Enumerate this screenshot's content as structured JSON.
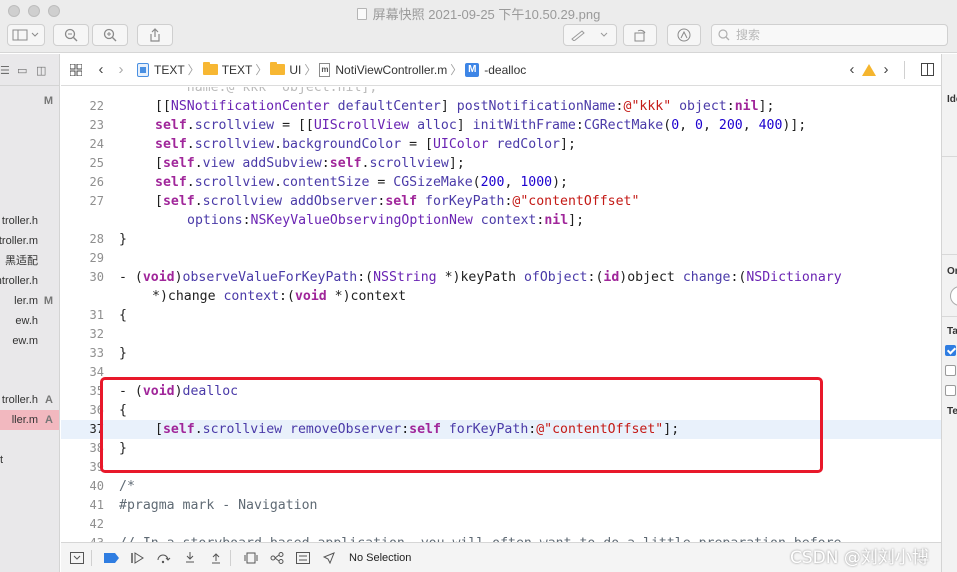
{
  "window": {
    "title": "屏幕快照 2021-09-25 下午10.50.29.png"
  },
  "toolbar": {
    "search_placeholder": "搜索"
  },
  "navigator": {
    "rows": [
      {
        "label": "",
        "badge": "M",
        "selected": false
      },
      {
        "label": "troller.h",
        "badge": "",
        "selected": false
      },
      {
        "label": "troller.m",
        "badge": "",
        "selected": false
      },
      {
        "label": "黑适配",
        "badge": "",
        "selected": false
      },
      {
        "label": "ntroller.h",
        "badge": "",
        "selected": false
      },
      {
        "label": "ler.m",
        "badge": "M",
        "selected": false
      },
      {
        "label": "ew.h",
        "badge": "",
        "selected": false
      },
      {
        "label": "ew.m",
        "badge": "",
        "selected": false
      },
      {
        "label": "troller.h",
        "badge": "A",
        "selected": false
      },
      {
        "label": "ller.m",
        "badge": "A",
        "selected": true
      },
      {
        "label": "t",
        "badge": "",
        "selected": false
      }
    ]
  },
  "jumpbar": {
    "project": "TEXT",
    "group": "TEXT",
    "folder": "UI",
    "file": "NotiViewController.m",
    "method": "-dealloc"
  },
  "editor": {
    "current_line": "37",
    "lines": [
      {
        "n": "",
        "text": "    name:@\"kkk\" object:nil];"
      },
      {
        "n": "22",
        "text": "[[NSNotificationCenter defaultCenter] postNotificationName:@\"kkk\" object:nil];"
      },
      {
        "n": "23",
        "text": "self.scrollview = [[UIScrollView alloc] initWithFrame:CGRectMake(0, 0, 200, 400)];"
      },
      {
        "n": "24",
        "text": "self.scrollview.backgroundColor = [UIColor redColor];"
      },
      {
        "n": "25",
        "text": "[self.view addSubview:self.scrollview];"
      },
      {
        "n": "26",
        "text": "self.scrollview.contentSize = CGSizeMake(200, 1000);"
      },
      {
        "n": "27",
        "text": "[self.scrollview addObserver:self forKeyPath:@\"contentOffset\""
      },
      {
        "n": "",
        "text": "    options:NSKeyValueObservingOptionNew context:nil];"
      },
      {
        "n": "28",
        "text": "}"
      },
      {
        "n": "29",
        "text": ""
      },
      {
        "n": "30",
        "text": "- (void)observeValueForKeyPath:(NSString *)keyPath ofObject:(id)object change:(NSDictionary"
      },
      {
        "n": "",
        "text": "*)change context:(void *)context"
      },
      {
        "n": "31",
        "text": "{"
      },
      {
        "n": "32",
        "text": ""
      },
      {
        "n": "33",
        "text": "}"
      },
      {
        "n": "34",
        "text": ""
      },
      {
        "n": "35",
        "text": "- (void)dealloc"
      },
      {
        "n": "36",
        "text": "{"
      },
      {
        "n": "37",
        "text": "[self.scrollview removeObserver:self forKeyPath:@\"contentOffset\"];"
      },
      {
        "n": "38",
        "text": "}"
      },
      {
        "n": "39",
        "text": ""
      },
      {
        "n": "40",
        "text": "/*"
      },
      {
        "n": "41",
        "text": "#pragma mark - Navigation"
      },
      {
        "n": "42",
        "text": ""
      },
      {
        "n": "43",
        "text": "// In a storyboard-based application, you will often want to do a little preparation before"
      }
    ]
  },
  "inspector": {
    "labels": [
      "Ide",
      "Or",
      "Ta",
      "Te"
    ]
  },
  "debug": {
    "selection_label": "No Selection"
  },
  "watermark": {
    "text": "CSDN @刘刘小博"
  },
  "colors": {
    "highlight_box": "#e8182a",
    "selected_nav_row": "#f2b8bf",
    "keyword": "#a0269a",
    "string": "#c41a16",
    "number": "#1c00cf"
  }
}
